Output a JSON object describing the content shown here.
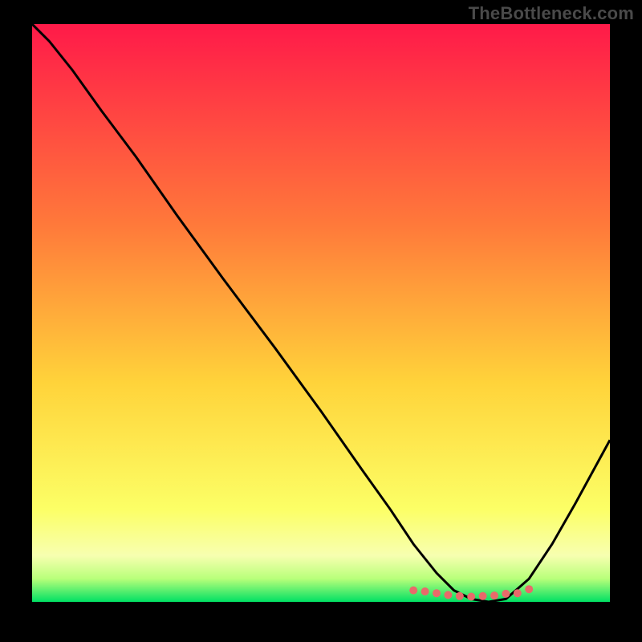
{
  "watermark": "TheBottleneck.com",
  "gradient": {
    "top": "#ff1a49",
    "mid1": "#ff7a3a",
    "mid2": "#ffd33a",
    "mid3": "#fcff66",
    "bottom_band": "#f7ffb0",
    "band_light": "#b8ff7a",
    "band_green": "#00e064"
  },
  "curve_color": "#000000",
  "marker_color": "#e86a6a",
  "chart_data": {
    "type": "line",
    "title": "",
    "xlabel": "",
    "ylabel": "",
    "xlim": [
      0,
      100
    ],
    "ylim": [
      0,
      100
    ],
    "series": [
      {
        "name": "bottleneck-curve",
        "x": [
          0,
          3,
          7,
          12,
          18,
          25,
          33,
          42,
          50,
          57,
          62,
          66,
          70,
          73,
          76,
          79,
          82,
          86,
          90,
          94,
          100
        ],
        "y": [
          100,
          97,
          92,
          85,
          77,
          67,
          56,
          44,
          33,
          23,
          16,
          10,
          5,
          2,
          0.5,
          0,
          0.5,
          4,
          10,
          17,
          28
        ]
      }
    ],
    "markers": {
      "name": "flat-region-dots",
      "x": [
        66,
        68,
        70,
        72,
        74,
        76,
        78,
        80,
        82,
        84,
        86
      ],
      "y": [
        2,
        1.8,
        1.5,
        1.2,
        1.0,
        0.9,
        1.0,
        1.1,
        1.4,
        1.5,
        2.2
      ]
    }
  }
}
